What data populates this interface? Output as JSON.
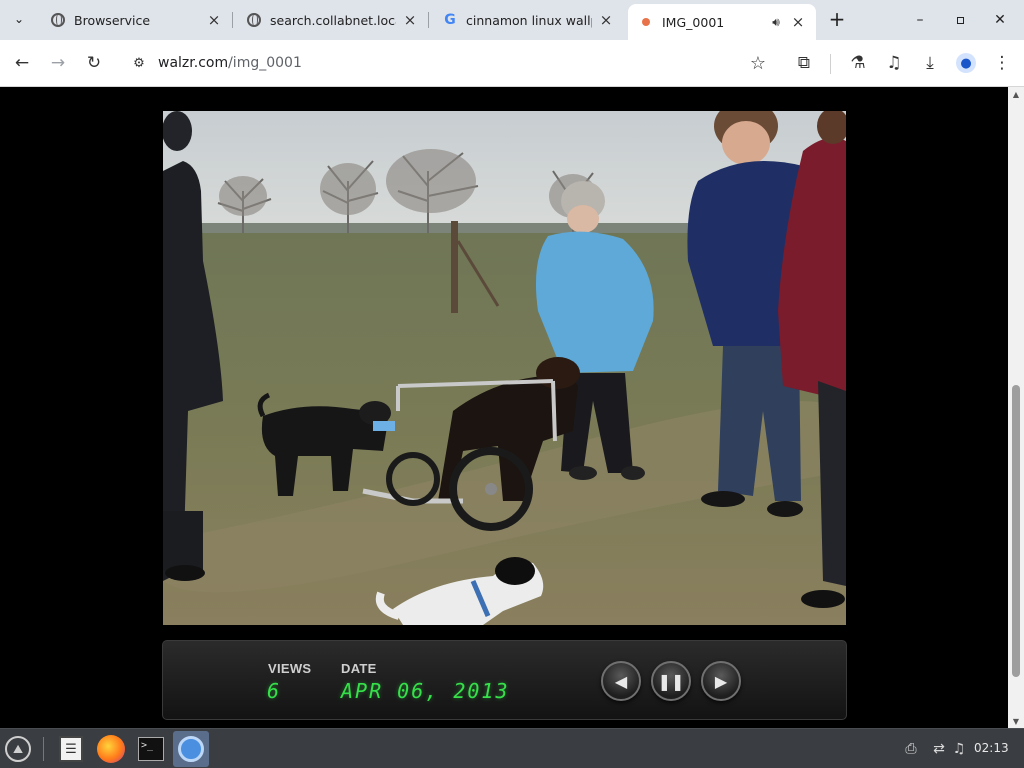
{
  "browser": {
    "tabs": [
      {
        "title": "Browservice",
        "icon": "globe-icon"
      },
      {
        "title": "search.collabnet.local",
        "icon": "globe-icon"
      },
      {
        "title": "cinnamon linux wallp",
        "icon": "google-icon"
      },
      {
        "title": "IMG_0001",
        "icon": "recording-dot-icon",
        "audio": "speaker-icon",
        "active": true
      }
    ],
    "url": {
      "host": "walzr.com",
      "path": "/img_0001"
    },
    "toolbar_icons": [
      "back-icon",
      "forward-icon",
      "reload-icon",
      "site-info-icon",
      "bookmark-star-icon",
      "extensions-icon",
      "labs-icon",
      "media-control-icon",
      "download-icon",
      "profile-icon",
      "menu-icon"
    ]
  },
  "viewer": {
    "views_label": "VIEWS",
    "views_value": "6",
    "date_label": "DATE",
    "date_value": "APR 06, 2013",
    "controls": [
      "previous-icon",
      "pause-icon",
      "next-icon"
    ]
  },
  "taskbar": {
    "apps": [
      "menu-icon",
      "file-manager-icon",
      "firefox-icon",
      "terminal-icon",
      "chromium-icon"
    ],
    "tray": [
      "printer-icon",
      "network-icon",
      "audio-icon"
    ],
    "clock": "02:13"
  },
  "colors": {
    "tabstrip": "#dfe3ea",
    "lcd_green": "#36e04a",
    "taskbar": "#3a3d41"
  }
}
